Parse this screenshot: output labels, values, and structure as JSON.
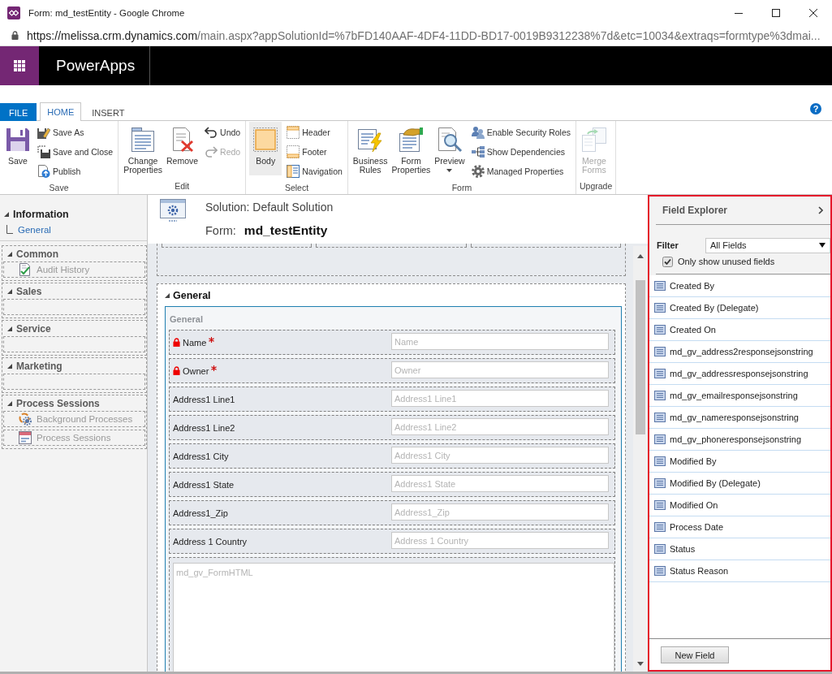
{
  "window": {
    "title": "Form: md_testEntity - Google Chrome"
  },
  "address_bar": {
    "host": "https://melissa.crm.dynamics.com",
    "path": "/main.aspx?appSolutionId=%7bFD140AAF-4DF4-11DD-BD17-0019B9312238%7d&etc=10034&extraqs=formtype%3dmai..."
  },
  "app_bar": {
    "title": "PowerApps"
  },
  "ribbon": {
    "tabs": [
      {
        "label": "FILE",
        "kind": "file",
        "selected": false
      },
      {
        "label": "HOME",
        "kind": "tab",
        "selected": true
      },
      {
        "label": "INSERT",
        "kind": "tab",
        "selected": false
      }
    ],
    "help": "?",
    "groups": [
      {
        "label": "Save",
        "large": [
          {
            "label": "Save",
            "disabled": false,
            "menu": false
          }
        ],
        "small": [
          {
            "label": "Save As",
            "disabled": false
          },
          {
            "label": "Save and Close",
            "disabled": false
          },
          {
            "label": "Publish",
            "disabled": false
          }
        ]
      },
      {
        "label": "Edit",
        "large": [
          {
            "label": "Change Properties",
            "disabled": false,
            "menu": false
          },
          {
            "label": "Remove",
            "disabled": false,
            "menu": false
          }
        ],
        "small": [
          {
            "label": "Undo",
            "disabled": false
          },
          {
            "label": "Redo",
            "disabled": true
          }
        ]
      },
      {
        "label": "Select",
        "large": [
          {
            "label": "Body",
            "disabled": false,
            "menu": false,
            "selected": true
          }
        ],
        "small": [
          {
            "label": "Header",
            "disabled": false,
            "selected": false
          },
          {
            "label": "Footer",
            "disabled": false,
            "selected": false
          },
          {
            "label": "Navigation",
            "disabled": false,
            "selected": false
          }
        ]
      },
      {
        "label": "Form",
        "large": [
          {
            "label": "Business Rules",
            "disabled": false,
            "menu": false
          },
          {
            "label": "Form Properties",
            "disabled": false,
            "menu": false
          },
          {
            "label": "Preview",
            "disabled": false,
            "menu": true
          }
        ],
        "small": [
          {
            "label": "Enable Security Roles",
            "disabled": false
          },
          {
            "label": "Show Dependencies",
            "disabled": false
          },
          {
            "label": "Managed Properties",
            "disabled": false
          }
        ]
      },
      {
        "label": "Upgrade",
        "large": [
          {
            "label": "Merge Forms",
            "disabled": true,
            "menu": false
          }
        ]
      }
    ]
  },
  "navigation": {
    "sections": [
      {
        "label": "Information",
        "kind": "fixed",
        "expanded": true,
        "children": [
          {
            "label": "General",
            "kind": "tab"
          }
        ]
      },
      {
        "label": "Common",
        "kind": "group",
        "expanded": true,
        "children": [
          {
            "label": "Audit History",
            "kind": "link"
          }
        ]
      },
      {
        "label": "Sales",
        "kind": "group",
        "expanded": true
      },
      {
        "label": "Service",
        "kind": "group",
        "expanded": true
      },
      {
        "label": "Marketing",
        "kind": "group",
        "expanded": true
      },
      {
        "label": "Process Sessions",
        "kind": "group",
        "expanded": true,
        "children": [
          {
            "label": "Background Processes",
            "kind": "link"
          },
          {
            "label": "Process Sessions",
            "kind": "link"
          }
        ]
      }
    ]
  },
  "form_header": {
    "solution": "Solution: Default Solution",
    "form_label": "Form:",
    "form_name": "md_testEntity"
  },
  "form": {
    "tabs": [
      {
        "label": "General",
        "expanded": true,
        "sections": [
          {
            "label": "General",
            "label_hidden": true,
            "selected": true,
            "fields": [
              {
                "kind": "text",
                "label": "Name",
                "required": true,
                "locked": true,
                "placeholder": "Name"
              },
              {
                "kind": "text",
                "label": "Owner",
                "required": true,
                "locked": true,
                "placeholder": "Owner"
              },
              {
                "kind": "text",
                "label": "Address1 Line1",
                "required": false,
                "locked": false,
                "placeholder": "Address1 Line1"
              },
              {
                "kind": "text",
                "label": "Address1 Line2",
                "required": false,
                "locked": false,
                "placeholder": "Address1 Line2"
              },
              {
                "kind": "text",
                "label": "Address1 City",
                "required": false,
                "locked": false,
                "placeholder": "Address1 City"
              },
              {
                "kind": "text",
                "label": "Address1 State",
                "required": false,
                "locked": false,
                "placeholder": "Address1 State"
              },
              {
                "kind": "text",
                "label": "Address1_Zip",
                "required": false,
                "locked": false,
                "placeholder": "Address1_Zip"
              },
              {
                "kind": "text",
                "label": "Address 1 Country",
                "required": false,
                "locked": false,
                "placeholder": "Address 1 Country"
              },
              {
                "kind": "webresource",
                "label": "md_gv_FormHTML"
              }
            ]
          }
        ]
      }
    ]
  },
  "field_explorer": {
    "title": "Field Explorer",
    "highlighted": true,
    "filter_label": "Filter",
    "filter_value": "All Fields",
    "unused_only": {
      "label": "Only show unused fields",
      "checked": true
    },
    "fields": [
      "Created By",
      "Created By (Delegate)",
      "Created On",
      "md_gv_address2responsejsonstring",
      "md_gv_addressresponsejsonstring",
      "md_gv_emailresponsejsonstring",
      "md_gv_nameresponsejsonstring",
      "md_gv_phoneresponsejsonstring",
      "Modified By",
      "Modified By (Delegate)",
      "Modified On",
      "Process Date",
      "Status",
      "Status Reason"
    ],
    "new_button": "New Field"
  }
}
